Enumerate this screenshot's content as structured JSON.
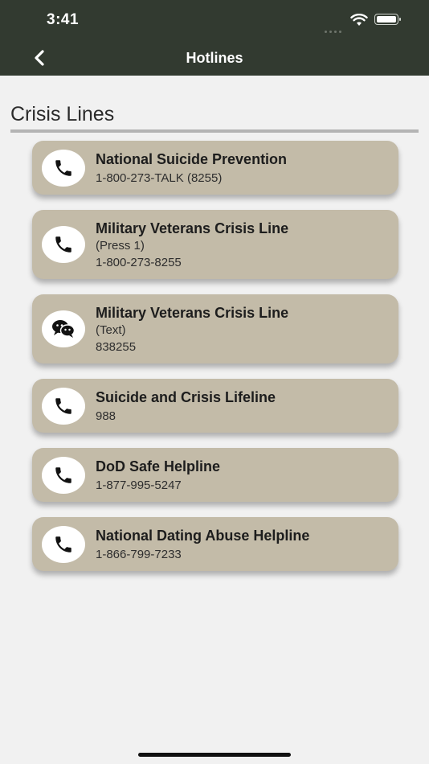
{
  "status": {
    "time": "3:41"
  },
  "nav": {
    "title": "Hotlines"
  },
  "section": {
    "title": "Crisis Lines"
  },
  "hotlines": [
    {
      "name": "National Suicide Prevention",
      "lines": [
        "1-800-273-TALK (8255)"
      ],
      "icon": "phone-icon"
    },
    {
      "name": "Military Veterans Crisis Line",
      "lines": [
        "(Press 1)",
        "1-800-273-8255"
      ],
      "icon": "phone-icon"
    },
    {
      "name": "Military Veterans Crisis Line",
      "lines": [
        "(Text)",
        "838255"
      ],
      "icon": "chat-bubbles-icon"
    },
    {
      "name": "Suicide and Crisis Lifeline",
      "lines": [
        "988"
      ],
      "icon": "phone-icon"
    },
    {
      "name": "DoD Safe Helpline",
      "lines": [
        "1-877-995-5247"
      ],
      "icon": "phone-icon"
    },
    {
      "name": "National Dating Abuse Helpline",
      "lines": [
        "1-866-799-7233"
      ],
      "icon": "phone-icon"
    }
  ],
  "colors": {
    "header": "#323a30",
    "card": "#c3bba8",
    "background": "#f1f1f1"
  }
}
